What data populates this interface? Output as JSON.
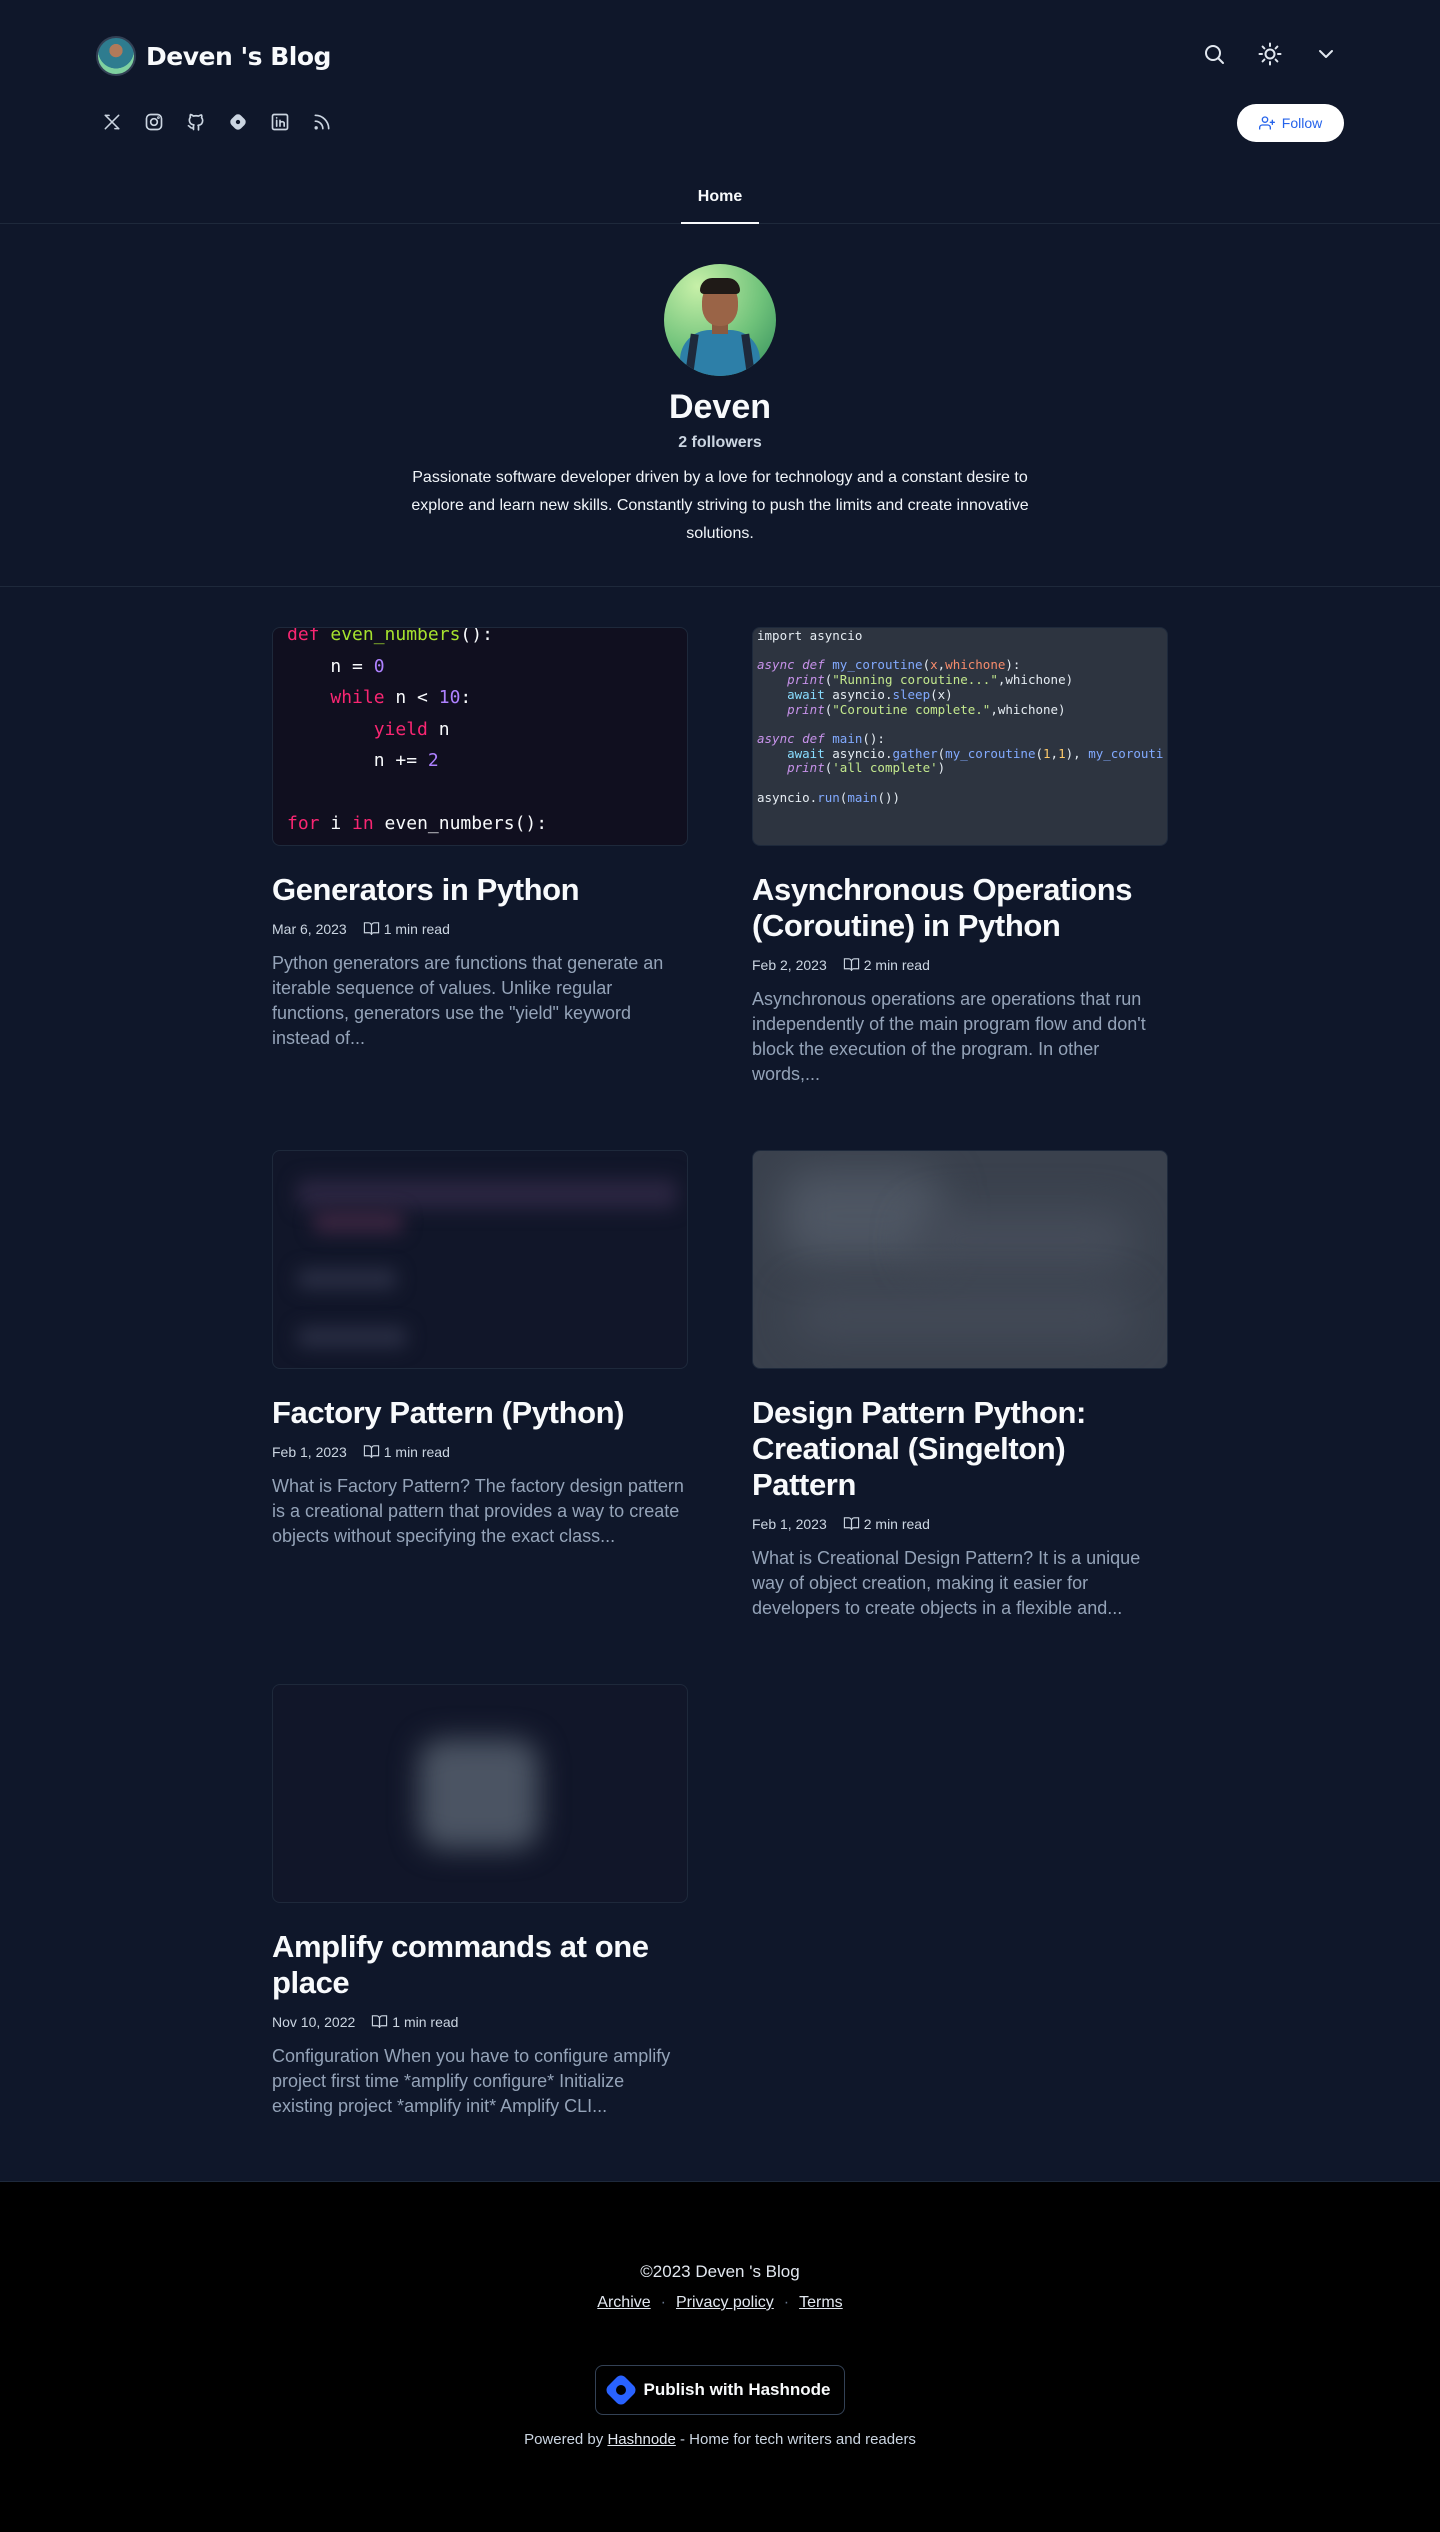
{
  "header": {
    "blog_title": "Deven 's Blog",
    "follow_label": "Follow",
    "nav_home": "Home",
    "top_icons": [
      "search-icon",
      "sun-icon",
      "chevron-down-icon"
    ],
    "socials": [
      "x-icon",
      "instagram-icon",
      "github-icon",
      "hashnode-icon",
      "linkedin-icon",
      "rss-icon"
    ]
  },
  "profile": {
    "name": "Deven",
    "followers": "2 followers",
    "bio": "Passionate software developer driven by a love for technology and a constant desire to explore and learn new skills. Constantly striving to push the limits and create innovative solutions."
  },
  "posts": [
    {
      "title": "Generators in Python",
      "date": "Mar 6, 2023",
      "read": "1 min read",
      "excerpt": "Python generators are functions that generate an iterable sequence of values. Unlike regular functions, generators use the \"yield\" keyword instead of..."
    },
    {
      "title": "Asynchronous Operations (Coroutine) in Python",
      "date": "Feb 2, 2023",
      "read": "2 min read",
      "excerpt": "Asynchronous operations are operations that run independently of the main program flow and don't block the execution of the program. In other words,..."
    },
    {
      "title": "Factory Pattern (Python)",
      "date": "Feb 1, 2023",
      "read": "1 min read",
      "excerpt": "What is Factory Pattern? The factory design pattern is a creational pattern that provides a way to create objects without specifying the exact class..."
    },
    {
      "title": "Design Pattern Python: Creational (Singelton) Pattern",
      "date": "Feb 1, 2023",
      "read": "2 min read",
      "excerpt": "What is Creational Design Pattern? It is a unique way of object creation, making it easier for developers to create objects in a flexible and..."
    },
    {
      "title": "Amplify commands at one place",
      "date": "Nov 10, 2022",
      "read": "1 min read",
      "excerpt": "Configuration When you have to configure amplify project first time *amplify configure* Initialize existing project *amplify init* Amplify CLI..."
    }
  ],
  "footer": {
    "copyright": "©2023 Deven 's Blog",
    "links": [
      "Archive",
      "Privacy policy",
      "Terms"
    ],
    "publish_label": "Publish with Hashnode",
    "powered_prefix": "Powered by",
    "powered_link": "Hashnode",
    "powered_suffix": "- Home for tech writers and readers"
  },
  "colors": {
    "background": "#0f172a",
    "footer_background": "#000000",
    "accent": "#2563eb",
    "hashnode_blue": "#2962ff"
  }
}
